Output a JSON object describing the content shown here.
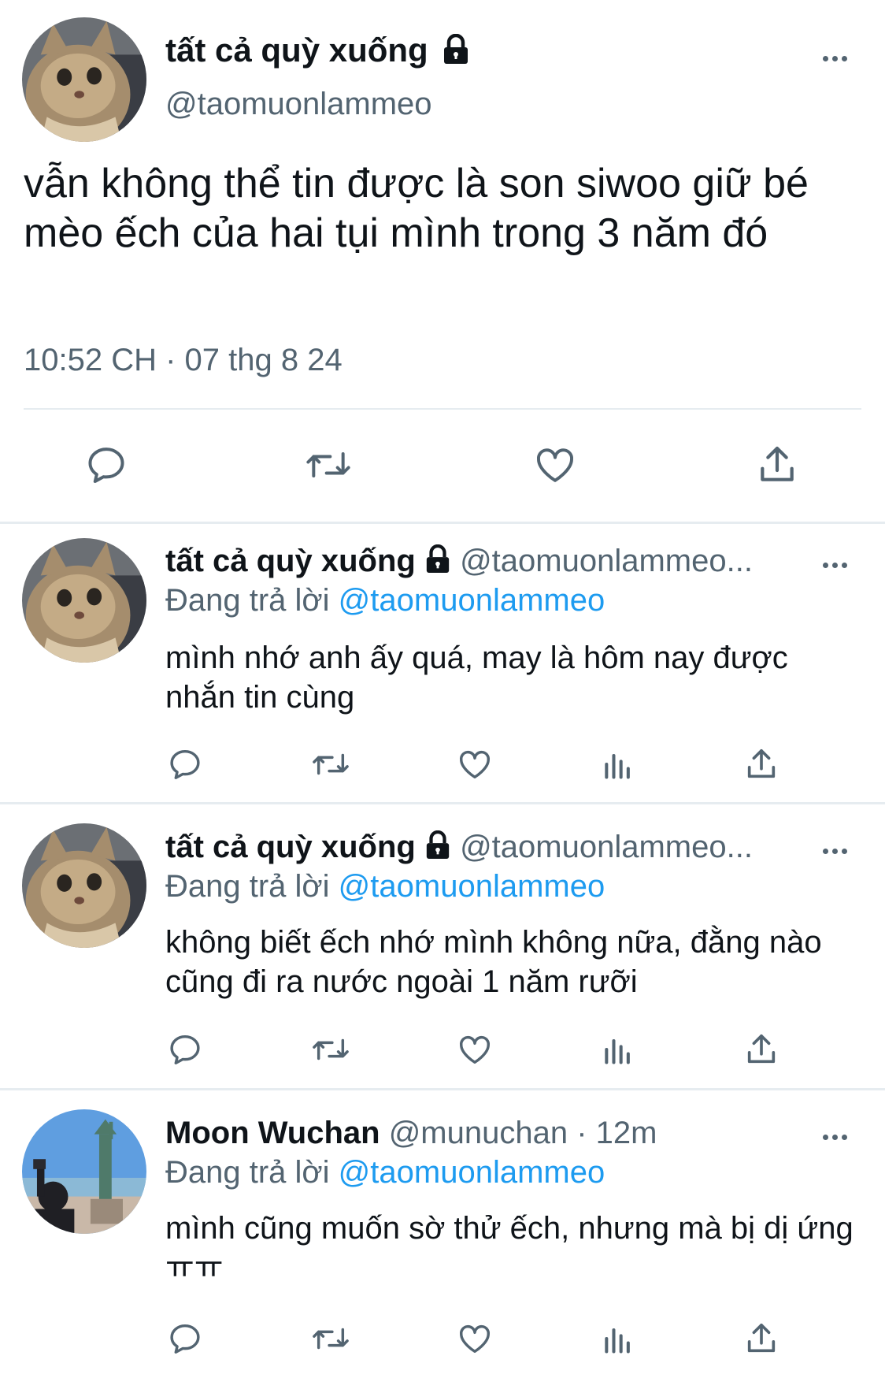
{
  "main_tweet": {
    "display_name": "tất cả quỳ xuống",
    "handle": "@taomuonlammeo",
    "text": "vẫn không thể tin được là son siwoo giữ bé mèo ếch của hai tụi mình trong 3 năm đó",
    "timestamp": "10:52 CH · 07 thg 8 24",
    "actions": [
      "reply-icon",
      "retweet-icon",
      "like-icon",
      "share-icon"
    ]
  },
  "replies": [
    {
      "display_name": "tất cả quỳ xuống",
      "handle": "@taomuonlammeo...",
      "replying_prefix": "Đang trả lời",
      "replying_to": "@taomuonlammeo",
      "text": "mình nhớ anh ấy quá, may là hôm nay được nhắn tin cùng"
    },
    {
      "display_name": "tất cả quỳ xuống",
      "handle": "@taomuonlammeo...",
      "replying_prefix": "Đang trả lời",
      "replying_to": "@taomuonlammeo",
      "text": "không biết ếch nhớ mình không nữa, đằng nào cũng đi ra nước ngoài 1 năm rưỡi"
    },
    {
      "display_name": "Moon Wuchan",
      "handle": "@munuchan · 12m",
      "replying_prefix": "Đang trả lời",
      "replying_to": "@taomuonlammeo",
      "text": "mình cũng muốn sờ thử ếch, nhưng mà bị dị ứngㅠㅠ"
    }
  ],
  "colors": {
    "text": "#0f1419",
    "secondary": "#536471",
    "link": "#1d9bf0",
    "divider": "#e6ecf0"
  }
}
